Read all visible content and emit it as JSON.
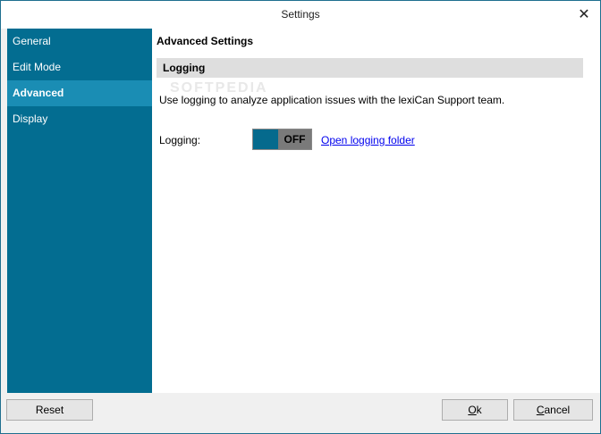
{
  "window": {
    "title": "Settings",
    "close_glyph": "✕"
  },
  "sidebar": {
    "items": [
      {
        "label": "General"
      },
      {
        "label": "Edit Mode"
      },
      {
        "label": "Advanced",
        "selected": true
      },
      {
        "label": "Display"
      }
    ]
  },
  "content": {
    "section_title": "Advanced Settings",
    "group_header": "Logging",
    "description": "Use logging to analyze application issues with the lexiCan Support team.",
    "logging": {
      "label": "Logging:",
      "toggle_state": "OFF",
      "link": "Open logging folder"
    },
    "watermark": "SOFTPEDIA"
  },
  "footer": {
    "reset_label": "Reset",
    "ok_label": "Ok",
    "cancel_label": "Cancel"
  },
  "colors": {
    "sidebar": "#036d91",
    "sidebar_selected": "#1a8db4",
    "toggle_on_track": "#056a8d",
    "toggle_knob": "#7a7a7a",
    "group_header": "#dedede",
    "link": "#0000ee"
  },
  "icons": {
    "close": "close-icon"
  }
}
